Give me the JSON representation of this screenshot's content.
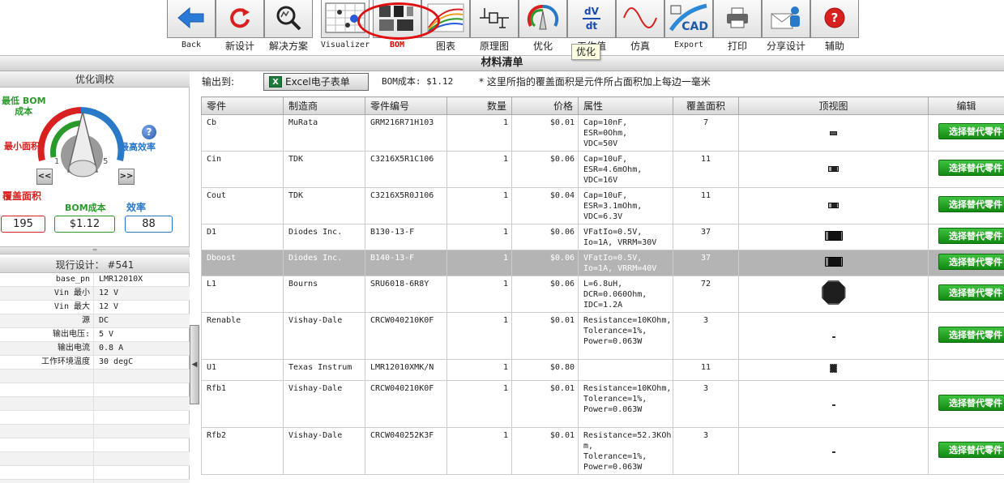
{
  "toolbar": {
    "items": [
      {
        "label": "Back",
        "icon": "back-arrow-icon",
        "small": true
      },
      {
        "label": "新设计",
        "icon": "refresh-icon"
      },
      {
        "label": "解决方案",
        "icon": "magnifier-icon"
      },
      {
        "label": "Visualizer",
        "icon": "visualizer-icon",
        "small": true
      },
      {
        "label": "BOM",
        "icon": "bom-icon",
        "small": true,
        "active": true
      },
      {
        "label": "图表",
        "icon": "chart-icon"
      },
      {
        "label": "原理图",
        "icon": "schematic-icon"
      },
      {
        "label": "优化",
        "icon": "optimize-knob-icon"
      },
      {
        "label": "工作值",
        "icon": "dvdt-icon"
      },
      {
        "label": "仿真",
        "icon": "sine-wave-icon"
      },
      {
        "label": "Export",
        "icon": "cad-icon",
        "small": true
      },
      {
        "label": "打印",
        "icon": "printer-icon"
      },
      {
        "label": "分享设计",
        "icon": "share-icon"
      },
      {
        "label": "辅助",
        "icon": "help-icon"
      }
    ],
    "tooltip": "优化",
    "dvdt_top": "dV",
    "dvdt_bottom": "dt",
    "cad_text": "CAD"
  },
  "title": "材料清单",
  "left": {
    "optimize_title": "优化调校",
    "label_bom_low": "最低 BOM\n成本",
    "label_min_area": "最小面积",
    "label_max_eff": "最高效率",
    "scale_1": "1",
    "scale_5": "5",
    "help": "?",
    "prev": "<<",
    "next": ">>",
    "metrics": [
      {
        "label": "覆盖面积",
        "value": "195",
        "color": "#d82020"
      },
      {
        "label": "BOM成本",
        "value": "$1.12",
        "color": "#2a9a2a"
      },
      {
        "label": "效率",
        "value": "88",
        "color": "#2a78c8"
      }
    ],
    "current_title": "现行设计： #541",
    "props": [
      {
        "k": "base_pn",
        "v": "LMR12010X"
      },
      {
        "k": "Vin 最小",
        "v": "12 V"
      },
      {
        "k": "Vin 最大",
        "v": "12 V"
      },
      {
        "k": "源",
        "v": "DC"
      },
      {
        "k": "输出电压:",
        "v": "5 V"
      },
      {
        "k": "输出电流",
        "v": "0.8 A"
      },
      {
        "k": "工作环境温度",
        "v": "30 degC"
      },
      {
        "k": "",
        "v": ""
      },
      {
        "k": "",
        "v": ""
      },
      {
        "k": "",
        "v": ""
      },
      {
        "k": "",
        "v": ""
      },
      {
        "k": "",
        "v": ""
      },
      {
        "k": "",
        "v": ""
      },
      {
        "k": "",
        "v": ""
      },
      {
        "k": "",
        "v": ""
      },
      {
        "k": "",
        "v": ""
      }
    ]
  },
  "main": {
    "export_label": "输出到:",
    "excel_icon": "X",
    "excel_button": "Excel电子表单",
    "bom_cost": "BOM成本: $1.12",
    "note": "* 这里所指的覆盖面积是元件所占面积加上每边一毫米",
    "columns": [
      "零件",
      "制造商",
      "零件编号",
      "数量",
      "价格",
      "属性",
      "覆盖面积",
      "顶视图",
      "编辑"
    ],
    "replace_label": "选择替代零件",
    "rows": [
      {
        "part": "Cb",
        "mfr": "MuRata",
        "pn": "GRM216R71H103",
        "qty": "1",
        "price": "$0.01",
        "attr": "Cap=10nF,\nESR=0Ohm,\nVDC=50V",
        "area": "7",
        "fp": "fp-smd",
        "editable": true,
        "h": 45
      },
      {
        "part": "Cin",
        "mfr": "TDK",
        "pn": "C3216X5R1C106",
        "qty": "1",
        "price": "$0.06",
        "attr": "Cap=10uF,\nESR=4.6mOhm,\nVDC=16V",
        "area": "11",
        "fp": "fp-1206",
        "editable": true,
        "h": 45
      },
      {
        "part": "Cout",
        "mfr": "TDK",
        "pn": "C3216X5R0J106",
        "qty": "1",
        "price": "$0.04",
        "attr": "Cap=10uF,\nESR=3.1mOhm,\nVDC=6.3V",
        "area": "11",
        "fp": "fp-1206",
        "editable": true,
        "h": 45
      },
      {
        "part": "D1",
        "mfr": "Diodes Inc.",
        "pn": "B130-13-F",
        "qty": "1",
        "price": "$0.06",
        "attr": "VFatIo=0.5V,\nIo=1A, VRRM=30V",
        "area": "37",
        "fp": "fp-diode",
        "editable": true,
        "h": 32
      },
      {
        "part": "Dboost",
        "mfr": "Diodes Inc.",
        "pn": "B140-13-F",
        "qty": "1",
        "price": "$0.06",
        "attr": "VFatIo=0.5V,\nIo=1A, VRRM=40V",
        "area": "37",
        "fp": "fp-diode",
        "editable": true,
        "selected": true,
        "h": 32
      },
      {
        "part": "L1",
        "mfr": "Bourns",
        "pn": "SRU6018-6R8Y",
        "qty": "1",
        "price": "$0.06",
        "attr": "L=6.8uH,\nDCR=0.060Ohm,\nIDC=1.2A",
        "area": "72",
        "fp": "fp-ind",
        "editable": true,
        "h": 45
      },
      {
        "part": "Renable",
        "mfr": "Vishay-Dale",
        "pn": "CRCW040210K0F",
        "qty": "1",
        "price": "$0.01",
        "attr": "Resistance=10KOhm,\nTolerance=1%,\nPower=0.063W",
        "area": "3",
        "fp": "fp-tiny",
        "editable": true,
        "h": 58
      },
      {
        "part": "U1",
        "mfr": "Texas Instrum",
        "pn": "LMR12010XMK/N",
        "qty": "1",
        "price": "$0.80",
        "attr": "",
        "area": "11",
        "fp": "fp-ic",
        "editable": false,
        "h": 26
      },
      {
        "part": "Rfb1",
        "mfr": "Vishay-Dale",
        "pn": "CRCW040210K0F",
        "qty": "1",
        "price": "$0.01",
        "attr": "Resistance=10KOhm,\nTolerance=1%,\nPower=0.063W",
        "area": "3",
        "fp": "fp-tiny",
        "editable": true,
        "h": 58
      },
      {
        "part": "Rfb2",
        "mfr": "Vishay-Dale",
        "pn": "CRCW040252K3F",
        "qty": "1",
        "price": "$0.01",
        "attr": "Resistance=52.3KOhm,\nTolerance=1%,\nPower=0.063W",
        "area": "3",
        "fp": "fp-tiny",
        "editable": true,
        "h": 58
      }
    ]
  }
}
